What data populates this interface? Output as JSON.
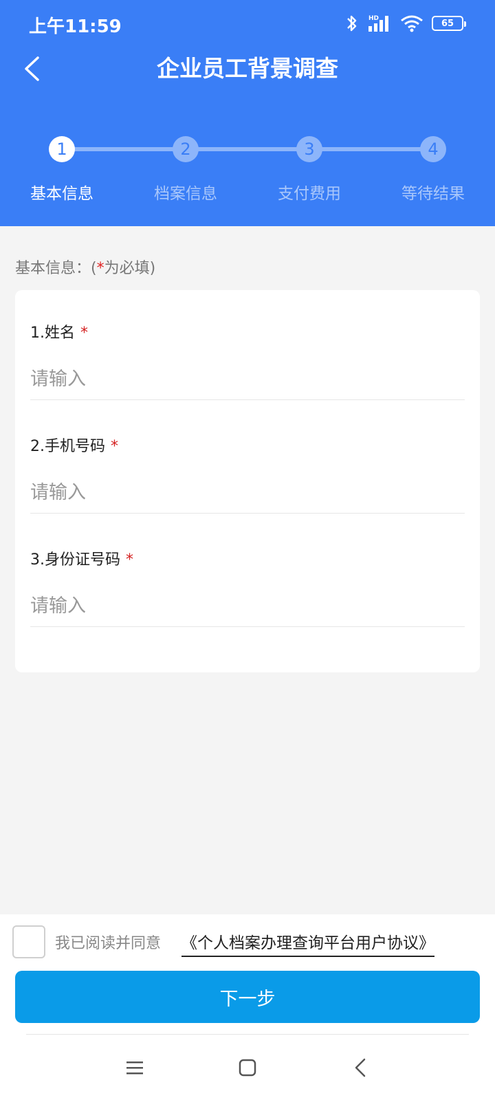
{
  "status_bar": {
    "time": "上午11:59",
    "battery": "65",
    "icons": [
      "bluetooth-icon",
      "signal-icon",
      "wifi-icon",
      "battery-icon"
    ]
  },
  "header": {
    "title": "企业员工背景调查",
    "back_icon": "chevron-left-icon"
  },
  "steps": [
    {
      "number": "1",
      "label": "基本信息",
      "active": true
    },
    {
      "number": "2",
      "label": "档案信息",
      "active": false
    },
    {
      "number": "3",
      "label": "支付费用",
      "active": false
    },
    {
      "number": "4",
      "label": "等待结果",
      "active": false
    }
  ],
  "form": {
    "section_title_prefix": "基本信息：(",
    "section_title_star": "*",
    "section_title_suffix": "为必填)",
    "fields": [
      {
        "label": "1.姓名",
        "required_mark": "*",
        "placeholder": "请输入",
        "value": ""
      },
      {
        "label": "2.手机号码",
        "required_mark": "*",
        "placeholder": "请输入",
        "value": ""
      },
      {
        "label": "3.身份证号码",
        "required_mark": "*",
        "placeholder": "请输入",
        "value": ""
      }
    ]
  },
  "agreement": {
    "checked": false,
    "text": "我已阅读并同意",
    "link": "《个人档案办理查询平台用户协议》"
  },
  "next_button": {
    "label": "下一步"
  },
  "nav_bar": {
    "icons": [
      "menu-icon",
      "home-square-icon",
      "back-icon"
    ]
  },
  "colors": {
    "header": "#3a7ef6",
    "primary_button": "#0a9be8",
    "required": "#d42020",
    "background": "#f4f4f4"
  }
}
